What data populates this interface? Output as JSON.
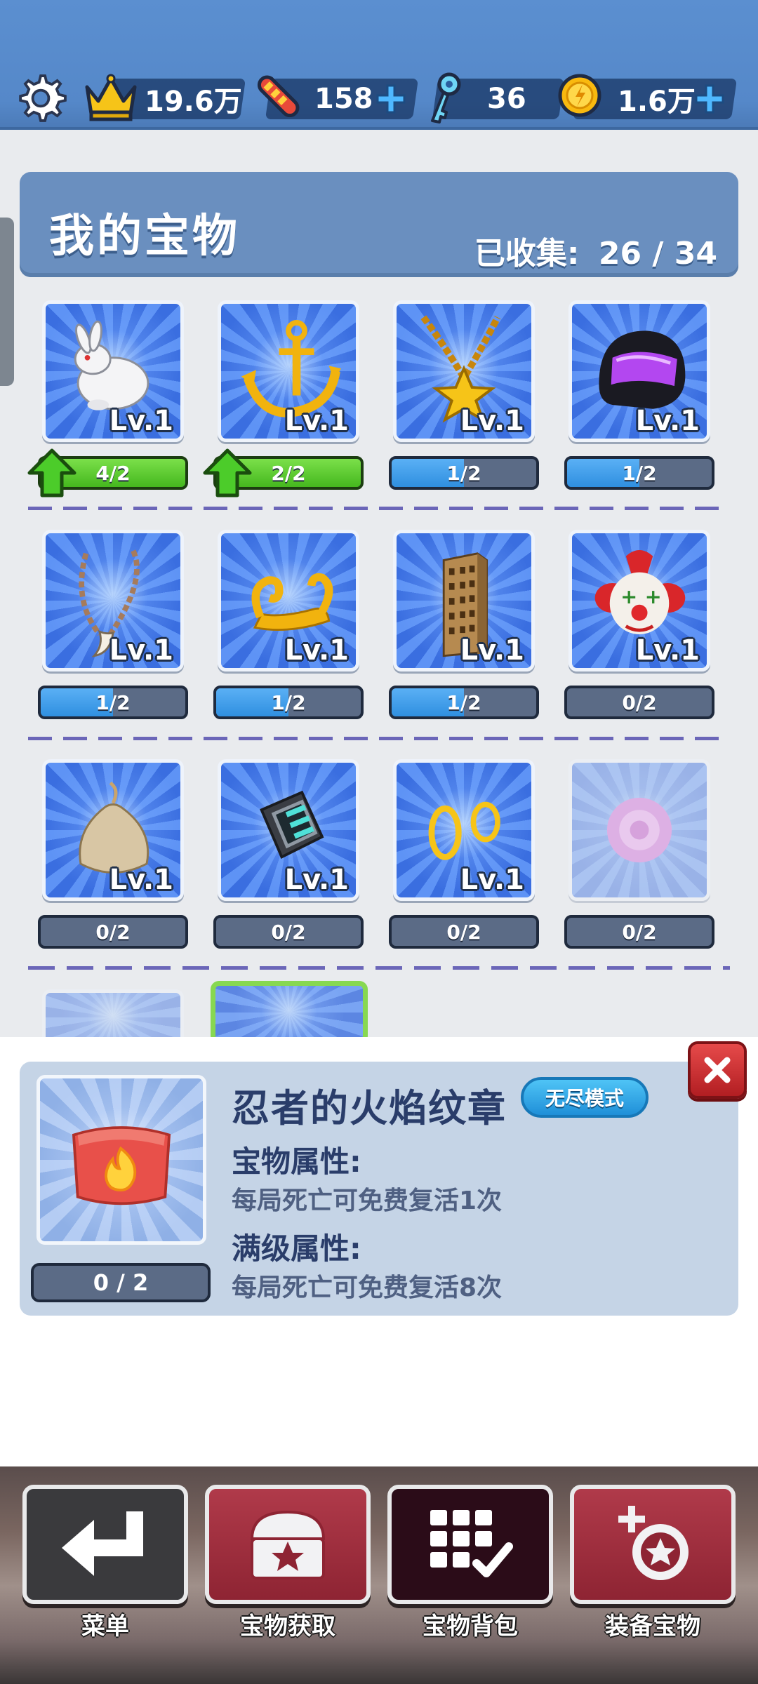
{
  "currency_bar": {
    "crowns": "19.6万",
    "hoverboards": "158",
    "keys": "36",
    "coins": "1.6万"
  },
  "collection": {
    "title": "我的宝物",
    "collected_label": "已收集:",
    "collected_value": "26 / 34"
  },
  "treasures": [
    {
      "name": "rabbit",
      "level": "Lv.1",
      "progress": "4/2",
      "fraction": 1.0,
      "state": "upgradable"
    },
    {
      "name": "anchor",
      "level": "Lv.1",
      "progress": "2/2",
      "fraction": 1.0,
      "state": "upgradable"
    },
    {
      "name": "star-necklace",
      "level": "Lv.1",
      "progress": "1/2",
      "fraction": 0.5,
      "state": "partial"
    },
    {
      "name": "helmet",
      "level": "Lv.1",
      "progress": "1/2",
      "fraction": 0.5,
      "state": "partial"
    },
    {
      "name": "fang-necklace",
      "level": "Lv.1",
      "progress": "1/2",
      "fraction": 0.5,
      "state": "partial"
    },
    {
      "name": "magic-carpet",
      "level": "Lv.1",
      "progress": "1/2",
      "fraction": 0.5,
      "state": "partial"
    },
    {
      "name": "skyscraper",
      "level": "Lv.1",
      "progress": "1/2",
      "fraction": 0.5,
      "state": "partial"
    },
    {
      "name": "clown-mask",
      "level": "Lv.1",
      "progress": "0/2",
      "fraction": 0.0,
      "state": "empty"
    },
    {
      "name": "coin-pouch",
      "level": "Lv.1",
      "progress": "0/2",
      "fraction": 0.0,
      "state": "empty"
    },
    {
      "name": "smart-watch",
      "level": "Lv.1",
      "progress": "0/2",
      "fraction": 0.0,
      "state": "empty"
    },
    {
      "name": "golden-rings",
      "level": "Lv.1",
      "progress": "0/2",
      "fraction": 0.0,
      "state": "empty"
    },
    {
      "name": "purple-flower",
      "level": "",
      "progress": "0/2",
      "fraction": 0.0,
      "state": "locked"
    }
  ],
  "detail": {
    "name": "忍者的火焰纹章",
    "mode_badge": "无尽模式",
    "progress": "0 / 2",
    "attr_title": "宝物属性:",
    "attr_text": "每局死亡可免费复活1次",
    "max_title": "满级属性:",
    "max_text": "每局死亡可免费复活8次"
  },
  "nav": {
    "menu": "菜单",
    "obtain": "宝物获取",
    "backpack": "宝物背包",
    "equip": "装备宝物"
  },
  "colors": {
    "top_bar": "#5b8fd0",
    "header_panel": "#6a8fbf",
    "progress_blue": "#2f8fe0",
    "progress_green": "#45b81e",
    "close_red": "#c0262c",
    "nav_red": "#9e2e3e"
  }
}
